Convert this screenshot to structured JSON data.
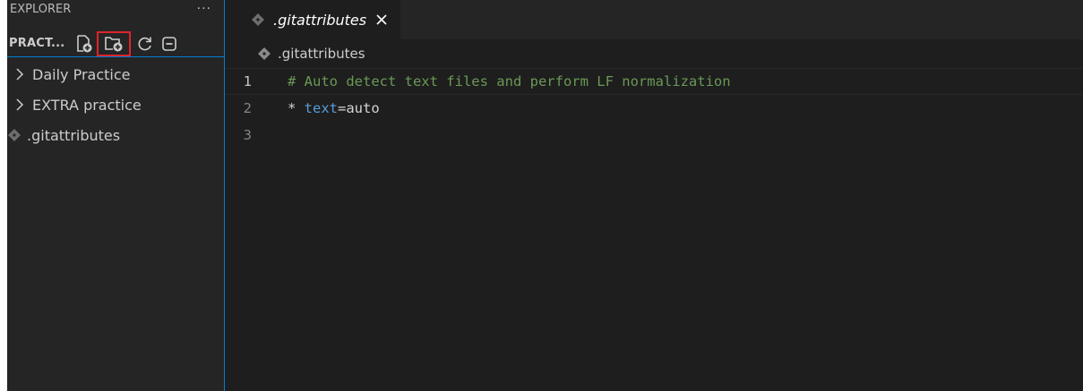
{
  "sidebar": {
    "title": "EXPLORER",
    "more": "···",
    "section_name": "PRACT...",
    "toolbar": [
      {
        "name": "new-file-icon"
      },
      {
        "name": "new-folder-icon"
      },
      {
        "name": "refresh-icon"
      },
      {
        "name": "collapse-all-icon"
      }
    ],
    "items": [
      {
        "label": "Daily Practice",
        "type": "folder"
      },
      {
        "label": "EXTRA practice",
        "type": "folder"
      },
      {
        "label": ".gitattributes",
        "type": "file"
      }
    ]
  },
  "editor": {
    "tab": {
      "label": ".gitattributes",
      "close": "✕"
    },
    "breadcrumb": ".gitattributes",
    "lines": [
      {
        "number": "1",
        "comment": "# Auto detect text files and perform LF normalization"
      },
      {
        "number": "2",
        "star": "* ",
        "key": "text",
        "rest": "=auto"
      },
      {
        "number": "3"
      }
    ]
  },
  "colors": {
    "accent": "#007fd4",
    "highlight_box": "#e0242b",
    "comment": "#6a9955",
    "keyword": "#569cd6"
  }
}
